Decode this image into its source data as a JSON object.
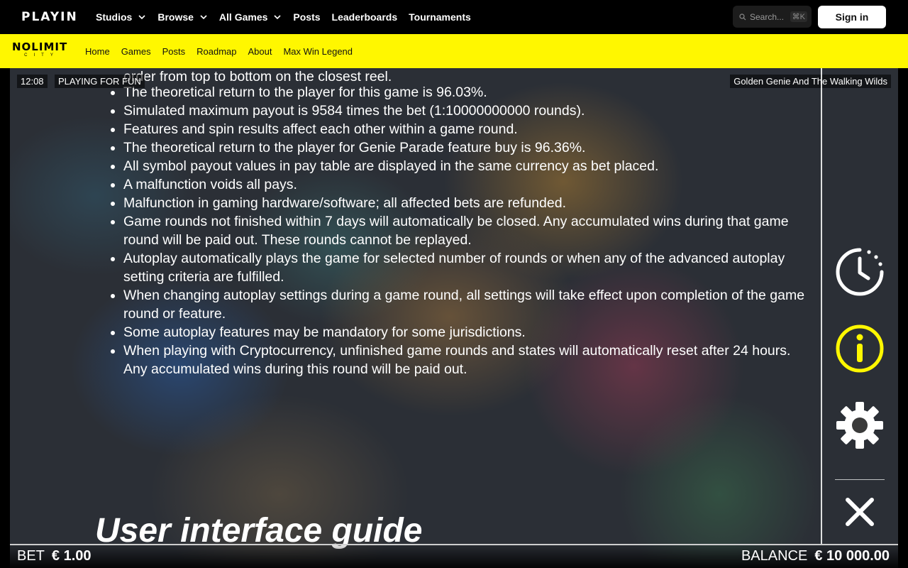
{
  "topnav": {
    "logo": "PLAYIN",
    "items": [
      {
        "label": "Studios",
        "dropdown": true
      },
      {
        "label": "Browse",
        "dropdown": true
      },
      {
        "label": "All Games",
        "dropdown": true
      },
      {
        "label": "Posts",
        "dropdown": false
      },
      {
        "label": "Leaderboards",
        "dropdown": false
      },
      {
        "label": "Tournaments",
        "dropdown": false
      }
    ],
    "search_placeholder": "Search...",
    "search_shortcut": "⌘K",
    "signin_label": "Sign in"
  },
  "studio": {
    "logo_main": "NOLIMIT",
    "logo_sub": "CITY",
    "links": [
      "Home",
      "Games",
      "Posts",
      "Roadmap",
      "About",
      "Max Win Legend"
    ],
    "accent": "#fff700"
  },
  "game": {
    "time": "12:08",
    "mode": "PLAYING FOR FUN",
    "title": "Golden Genie And The Walking Wilds",
    "rules_lead": "order from top to bottom on the closest reel.",
    "rules": [
      "The theoretical return to the player for this game is 96.03%.",
      "Simulated maximum payout is 9584 times the bet (1:10000000000 rounds).",
      "Features and spin results affect each other within a game round.",
      "The theoretical return to the player for Genie Parade feature buy is 96.36%.",
      "All symbol payout values in pay table are displayed in the same currency as bet placed.",
      "A malfunction voids all pays.",
      "Malfunction in gaming hardware/software; all affected bets are refunded.",
      "Game rounds not finished within 7 days will automatically be closed. Any accumulated wins during that game round will be paid out. These rounds cannot be replayed.",
      "Autoplay automatically plays the game for selected number of rounds or when any of the advanced autoplay setting criteria are fulfilled.",
      "When changing autoplay settings during a game round, all settings will take effect upon completion of the game round or feature.",
      "Some autoplay features may be mandatory for some jurisdictions.",
      "When playing with Cryptocurrency, unfinished game rounds and states will automatically reset after 24 hours. Any accumulated wins during this round will be paid out."
    ],
    "guide_title": "User interface guide",
    "bet_label": "BET",
    "bet_value": "€ 1.00",
    "balance_label": "BALANCE",
    "balance_value": "€ 10 000.00",
    "info_color": "#fff700"
  }
}
